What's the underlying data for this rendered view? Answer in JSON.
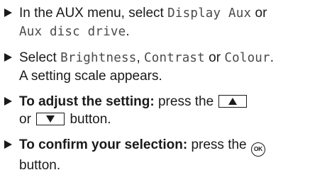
{
  "steps": [
    {
      "prefix": "In the AUX menu, select ",
      "option1": "Display Aux",
      "joiner": " or ",
      "option2": "Aux disc drive",
      "suffix": "."
    },
    {
      "prefix": "Select ",
      "option1": "Brightness",
      "sep1": ", ",
      "option2": "Contrast",
      "joiner": " or ",
      "option3": "Colour",
      "suffix": ".",
      "line2": "A setting scale appears."
    },
    {
      "bold": "To adjust the setting:",
      "text1": " press the ",
      "up_key_icon": "triangle-up",
      "text2": "or ",
      "down_key_icon": "triangle-down",
      "text3": " button."
    },
    {
      "bold": "To confirm your selection:",
      "text1": " press the ",
      "ok_key_label": "OK",
      "text2": "button."
    }
  ],
  "colors": {
    "text": "#1a1a1a",
    "option_text": "#4a4a4a"
  }
}
